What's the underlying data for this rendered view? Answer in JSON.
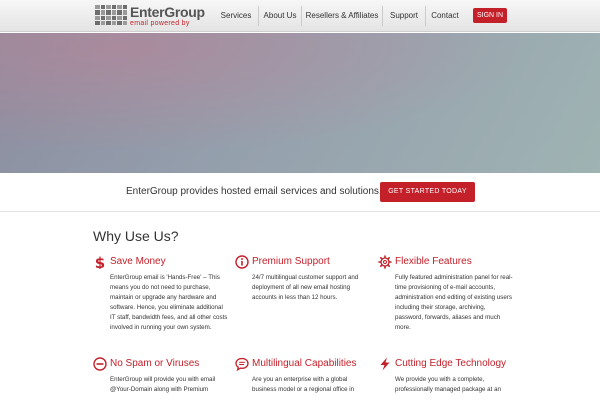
{
  "header": {
    "logo": {
      "name": "EnterGroup",
      "tagline": "email powered by"
    },
    "nav": [
      {
        "label": "Services"
      },
      {
        "label": "About Us"
      },
      {
        "label": "Resellers & Affiliates"
      },
      {
        "label": "Support"
      },
      {
        "label": "Contact"
      }
    ],
    "signin_label": "SIGN IN"
  },
  "cta": {
    "text": "EnterGroup provides hosted email services and solutions.",
    "button_label": "GET STARTED TODAY"
  },
  "why": {
    "title": "Why Use Us?",
    "features": [
      {
        "icon": "dollar-icon",
        "title": "Save Money",
        "body": "EnterGroup email is 'Hands-Free' – This means you do not need to purchase, maintain or upgrade any hardware and software. Hence, you eliminate additional IT staff, bandwidth fees, and all other costs involved in running your own system."
      },
      {
        "icon": "info-icon",
        "title": "Premium Support",
        "body": "24/7 multilingual customer support and deployment of all new email hosting accounts in less than 12 hours."
      },
      {
        "icon": "gear-icon",
        "title": "Flexible Features",
        "body": "Fully featured administration panel for real-time provisioning of e-mail accounts, administration end editing of existing users including their storage, archiving, password, forwards, aliases and much more."
      },
      {
        "icon": "no-entry-icon",
        "title": "No Spam or Viruses",
        "body": "EnterGroup will provide you with email @Your-Domain along with Premium"
      },
      {
        "icon": "chat-bubble-icon",
        "title": "Multilingual Capabilities",
        "body": "Are you an enterprise with a global business model or a regional office in"
      },
      {
        "icon": "lightning-icon",
        "title": "Cutting Edge Technology",
        "body": "We provide you with a complete, professionally managed package at an"
      }
    ]
  },
  "colors": {
    "accent": "#c4202a",
    "text": "#333333",
    "header_bg": "#eeeeee"
  }
}
